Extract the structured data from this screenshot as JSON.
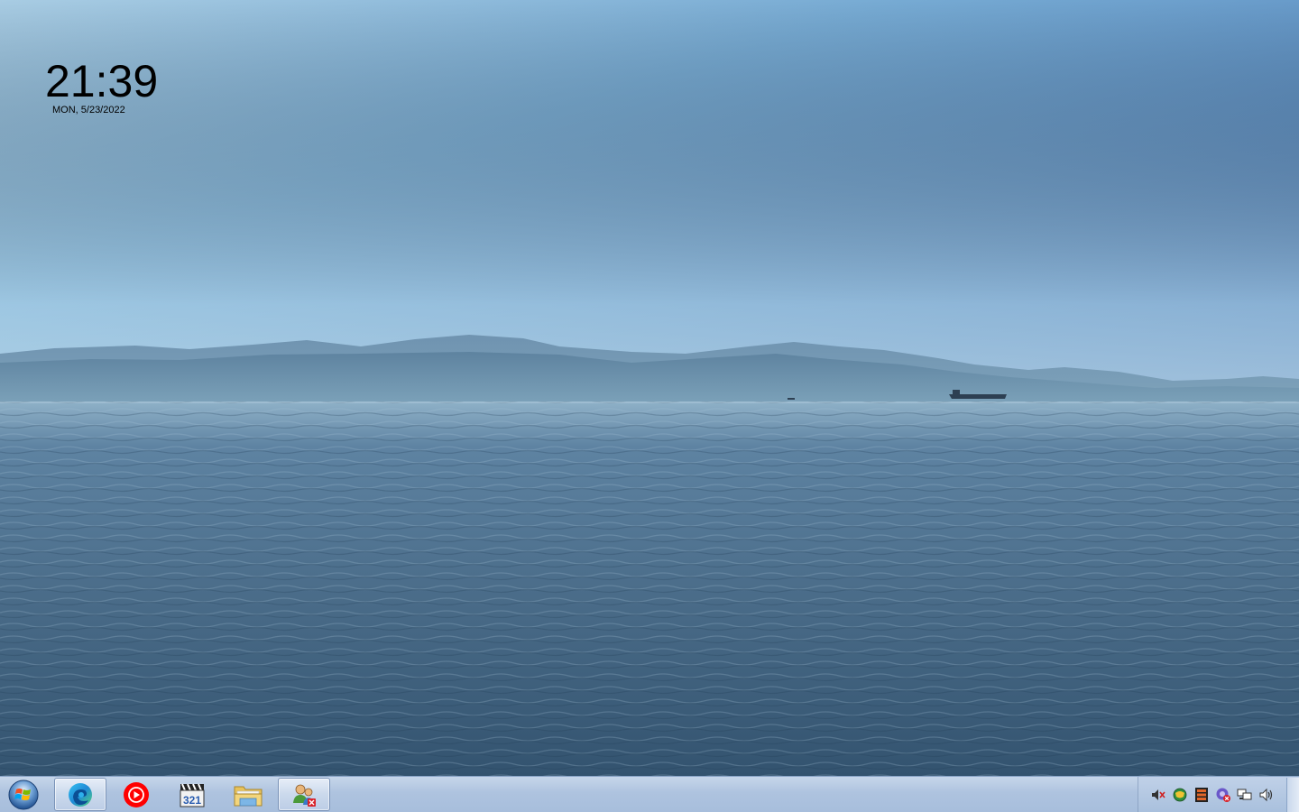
{
  "clock": {
    "time": "21:39",
    "date": "MON, 5/23/2022"
  },
  "taskbar": {
    "start_icon": "windows-orb-icon",
    "pinned": [
      {
        "name": "edge-icon",
        "active": true
      },
      {
        "name": "youtube-music-icon",
        "active": false
      },
      {
        "name": "media-player-classic-icon",
        "active": false
      },
      {
        "name": "file-explorer-icon",
        "active": false
      },
      {
        "name": "user-accounts-icon",
        "active": true
      }
    ]
  },
  "tray": {
    "icons": [
      "volume-mute-icon",
      "network-globe-icon",
      "film-strip-icon",
      "shield-error-icon",
      "network-icon",
      "speaker-icon"
    ]
  },
  "colors": {
    "taskbar": "#aec3df",
    "sky_top": "#3f70b0",
    "water": "#3b5c79"
  }
}
